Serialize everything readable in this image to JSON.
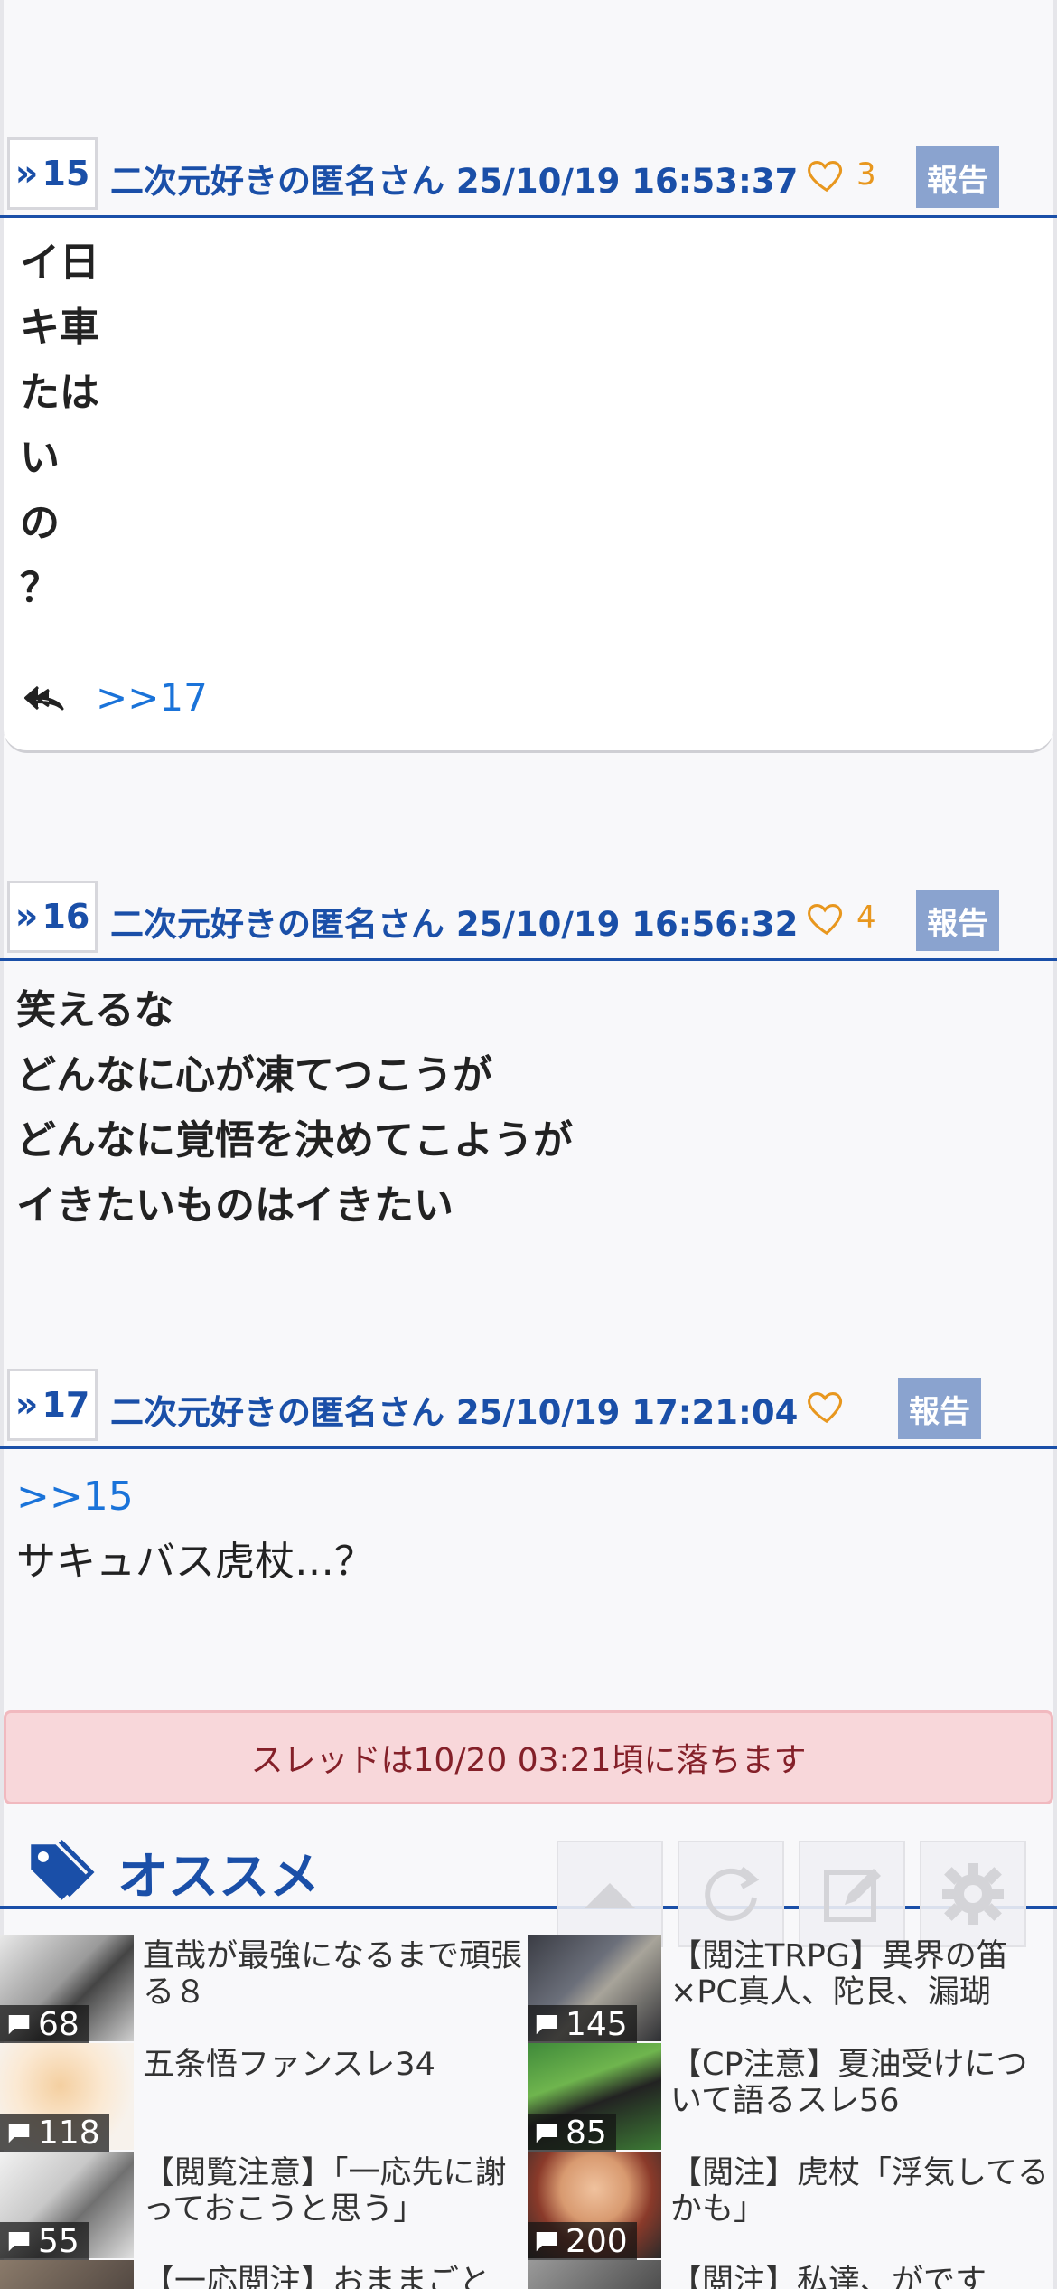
{
  "posts": [
    {
      "num": "15",
      "author": "二次元好きの匿名さん",
      "datetime": "25/10/19 16:53:37",
      "likes": "3",
      "report": "報告",
      "body": "イ日\nキ車\nたは\nい\nの\n？",
      "reply_ref": ">>17"
    },
    {
      "num": "16",
      "author": "二次元好きの匿名さん",
      "datetime": "25/10/19 16:56:32",
      "likes": "4",
      "report": "報告",
      "body": "笑えるな\nどんなに心が凍てつこうが\nどんなに覚悟を決めてこようが\nイきたいものはイきたい"
    },
    {
      "num": "17",
      "author": "二次元好きの匿名さん",
      "datetime": "25/10/19 17:21:04",
      "likes": "",
      "report": "報告",
      "quote": ">>15",
      "body": "サキュバス虎杖…？"
    }
  ],
  "notice": "スレッドは10/20 03:21頃に落ちます",
  "recommend": {
    "title": "オススメ",
    "items": [
      {
        "title": "直哉が最強になるまで頑張る８",
        "count": "68"
      },
      {
        "title": "【閲注TRPG】異界の笛×PC真人、陀艮、漏瑚",
        "count": "145"
      },
      {
        "title": "五条悟ファンスレ34",
        "count": "118"
      },
      {
        "title": "【CP注意】夏油受けについて語るスレ56",
        "count": "85"
      },
      {
        "title": "【閲覧注意】「一応先に謝っておこうと思う」",
        "count": "55"
      },
      {
        "title": "【閲注】虎杖「浮気してるかも」",
        "count": "200"
      },
      {
        "title": "【一応閲注】おままごと",
        "count": ""
      },
      {
        "title": "【閲注】私達、がです",
        "count": ""
      }
    ]
  },
  "colors": {
    "accent": "#1a4fa8",
    "link": "#1a73d9",
    "like": "#e8971e",
    "report_bg": "#8aa3cf",
    "notice_bg": "#f8d7da",
    "notice_text": "#842029"
  },
  "icons": [
    "heart-icon",
    "reply-icon",
    "tag-icon",
    "arrow-up-icon",
    "reload-icon",
    "edit-icon",
    "gear-icon",
    "comment-icon"
  ]
}
